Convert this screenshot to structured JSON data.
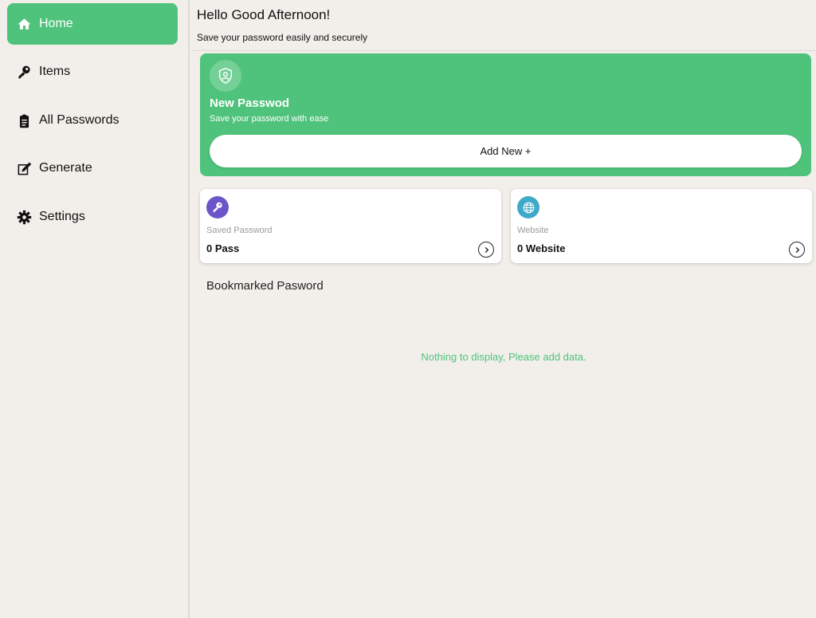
{
  "sidebar": {
    "items": [
      {
        "label": "Home",
        "icon": "home-icon",
        "active": true
      },
      {
        "label": "Items",
        "icon": "key-icon",
        "active": false
      },
      {
        "label": "All Passwords",
        "icon": "clipboard-icon",
        "active": false
      },
      {
        "label": "Generate",
        "icon": "edit-icon",
        "active": false
      },
      {
        "label": "Settings",
        "icon": "gear-icon",
        "active": false
      }
    ]
  },
  "header": {
    "greeting": "Hello Good Afternoon!",
    "subtitle": "Save your password easily and securely"
  },
  "hero": {
    "icon": "user-shield-icon",
    "title": "New Passwod",
    "subtitle": "Save your password with ease",
    "button_label": "Add New +"
  },
  "cards": [
    {
      "label": "Saved Password",
      "value": "0 Pass",
      "icon": "key-icon",
      "icon_color": "#6b55c9"
    },
    {
      "label": "Website",
      "value": "0 Website",
      "icon": "globe-icon",
      "icon_color": "#3fa9c9"
    }
  ],
  "bookmarks": {
    "title": "Bookmarked Pasword",
    "empty_message": "Nothing to display, Please add data."
  },
  "colors": {
    "accent": "#4fc37b",
    "background": "#f2efeb"
  }
}
